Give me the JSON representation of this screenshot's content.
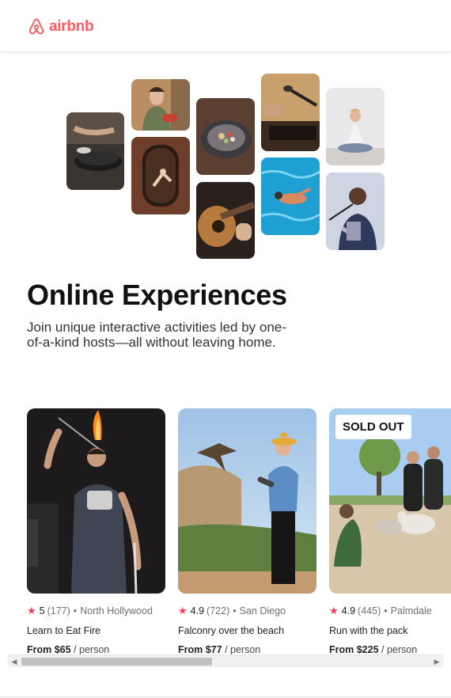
{
  "header": {
    "logo_text": "airbnb",
    "logo_icon": "airbnb-belo-icon",
    "brand_color": "#ff5a5f"
  },
  "collage": {
    "tiles": [
      {
        "subject": "pan cooking"
      },
      {
        "subject": "woman smiling cooking"
      },
      {
        "subject": "acrobat in doorway"
      },
      {
        "subject": "plated food bowl"
      },
      {
        "subject": "acoustic guitar"
      },
      {
        "subject": "record player / singer microphone"
      },
      {
        "subject": "swimmer in pool"
      },
      {
        "subject": "meditation"
      },
      {
        "subject": "singer with microphone"
      }
    ]
  },
  "hero": {
    "title": "Online Experiences",
    "subtitle": "Join unique interactive activities led by one-of-a-kind hosts—all without leaving home."
  },
  "cards": [
    {
      "badge": "",
      "rating": "5",
      "reviews": "(177)",
      "location": "North Hollywood",
      "title": "Learn to Eat Fire",
      "price": "From $65",
      "unit": "/ person"
    },
    {
      "badge": "",
      "rating": "4.9",
      "reviews": "(722)",
      "location": "San Diego",
      "title": "Falconry over the beach",
      "price": "From $77",
      "unit": "/ person"
    },
    {
      "badge": "SOLD OUT",
      "rating": "4.9",
      "reviews": "(445)",
      "location": "Palmdale",
      "title": "Run with the pack",
      "price": "From $225",
      "unit": "/ person"
    }
  ],
  "accent_color": "#ff385c"
}
